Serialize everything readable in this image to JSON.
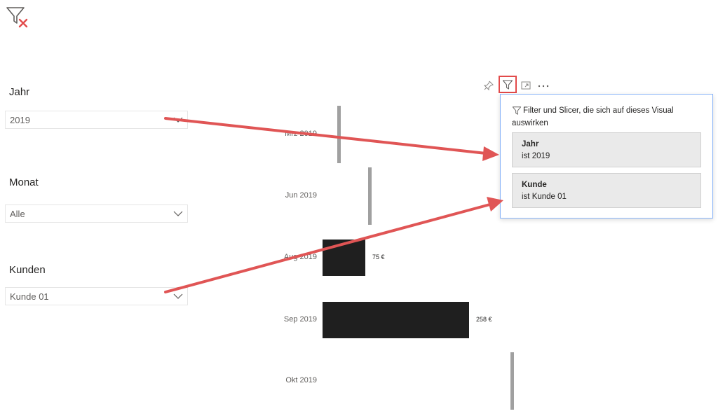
{
  "slicers": {
    "year": {
      "label": "Jahr",
      "value": "2019"
    },
    "month": {
      "label": "Monat",
      "value": "Alle"
    },
    "customer": {
      "label": "Kunden",
      "value": "Kunde 01"
    }
  },
  "visual_header": {
    "icons": [
      "pin-icon",
      "filter-icon",
      "focus-mode-icon",
      "more-options-icon"
    ],
    "highlight_color": "#e24a4a"
  },
  "filter_popup": {
    "title": "Filter und Slicer, die sich auf dieses Visual auswirken",
    "filters": [
      {
        "name": "Jahr",
        "condition": "ist 2019"
      },
      {
        "name": "Kunde",
        "condition": "ist Kunde 01"
      }
    ]
  },
  "chart_data": {
    "type": "bar",
    "categories": [
      "Mrz 2019",
      "Jun 2019",
      "Aug 2019",
      "Sep 2019",
      "Okt 2019"
    ],
    "data_labels": [
      "",
      "",
      "75 €",
      "258 €",
      ""
    ],
    "bar_color": "#1f1f1f",
    "marker_color": "#a0a0a0"
  },
  "annotation_color": "#e05555"
}
